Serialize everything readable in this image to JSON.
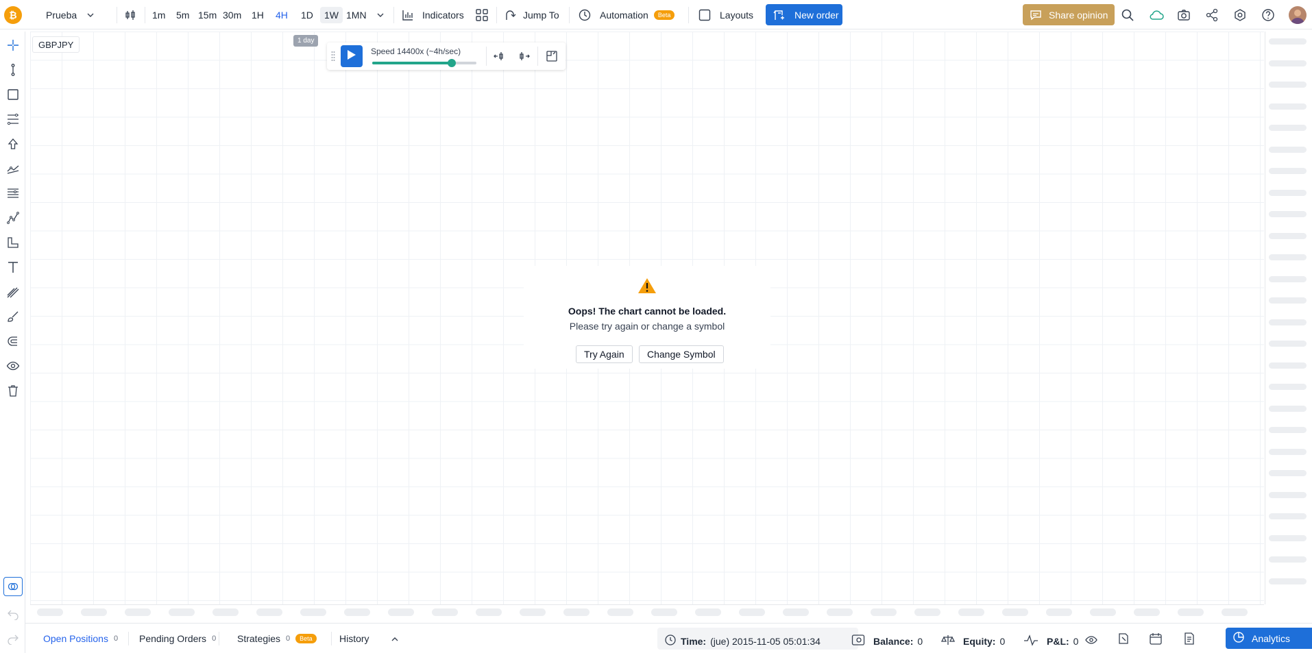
{
  "topbar": {
    "account": "Prueba",
    "timeframes": [
      "1m",
      "5m",
      "15m",
      "30m",
      "1H",
      "4H",
      "1D",
      "1W",
      "1MN"
    ],
    "active_timeframe": "4H",
    "indicators": "Indicators",
    "jump_to": "Jump To",
    "automation": "Automation",
    "automation_badge": "Beta",
    "layouts": "Layouts",
    "new_order": "New order",
    "share_opinion": "Share opinion",
    "accent": "#1e6fd9"
  },
  "tooltip": "1 day",
  "chart": {
    "symbol": "GBPJPY",
    "replay": {
      "speed_label": "Speed 14400x (~4h/sec)",
      "speed_fraction": 0.76
    },
    "error": {
      "title": "Oops! The chart cannot be loaded.",
      "subtitle": "Please try again or change a symbol",
      "try_again": "Try Again",
      "change_symbol": "Change Symbol"
    }
  },
  "footer": {
    "tabs": [
      {
        "label": "Open Positions",
        "count": "0"
      },
      {
        "label": "Pending Orders",
        "count": "0"
      },
      {
        "label": "Strategies",
        "count": "0",
        "badge": "Beta"
      },
      {
        "label": "History"
      }
    ],
    "time_label": "Time:",
    "time_value": "(jue) 2015-11-05 05:01:34",
    "balance_label": "Balance:",
    "balance_value": "0",
    "equity_label": "Equity:",
    "equity_value": "0",
    "pnl_label": "P&L:",
    "pnl_value": "0",
    "analytics": "Analytics"
  }
}
